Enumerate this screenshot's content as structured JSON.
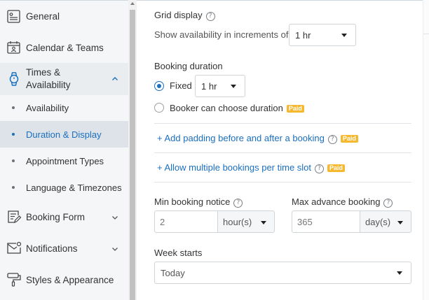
{
  "sidebar": {
    "general": "General",
    "calendar_teams": "Calendar & Teams",
    "times_availability_line1": "Times &",
    "times_availability_line2": "Availability",
    "sub_items": [
      "Availability",
      "Duration & Display",
      "Appointment Types",
      "Language & Timezones"
    ],
    "booking_form": "Booking Form",
    "notifications": "Notifications",
    "styles_appearance": "Styles & Appearance"
  },
  "grid_display": {
    "title": "Grid display",
    "increments_label": "Show availability in increments of",
    "increments_value": "1 hr"
  },
  "booking_duration": {
    "title": "Booking duration",
    "fixed_label": "Fixed",
    "fixed_value": "1 hr",
    "booker_choose_label": "Booker can choose duration",
    "paid_badge": "Paid"
  },
  "padding_link": "+ Add padding before and after a booking",
  "multiple_link": "+ Allow multiple bookings per time slot",
  "min_notice": {
    "label": "Min booking notice",
    "value": "2",
    "unit": "hour(s)"
  },
  "max_advance": {
    "label": "Max advance booking",
    "value": "365",
    "unit": "day(s)"
  },
  "week_starts": {
    "label": "Week starts",
    "value": "Today"
  },
  "help_glyph": "?",
  "colors": {
    "accent": "#1a6fbf",
    "paid": "#f5b82e",
    "sidebar_bg": "#f4f6f8",
    "active_bg": "#dde3e8"
  }
}
